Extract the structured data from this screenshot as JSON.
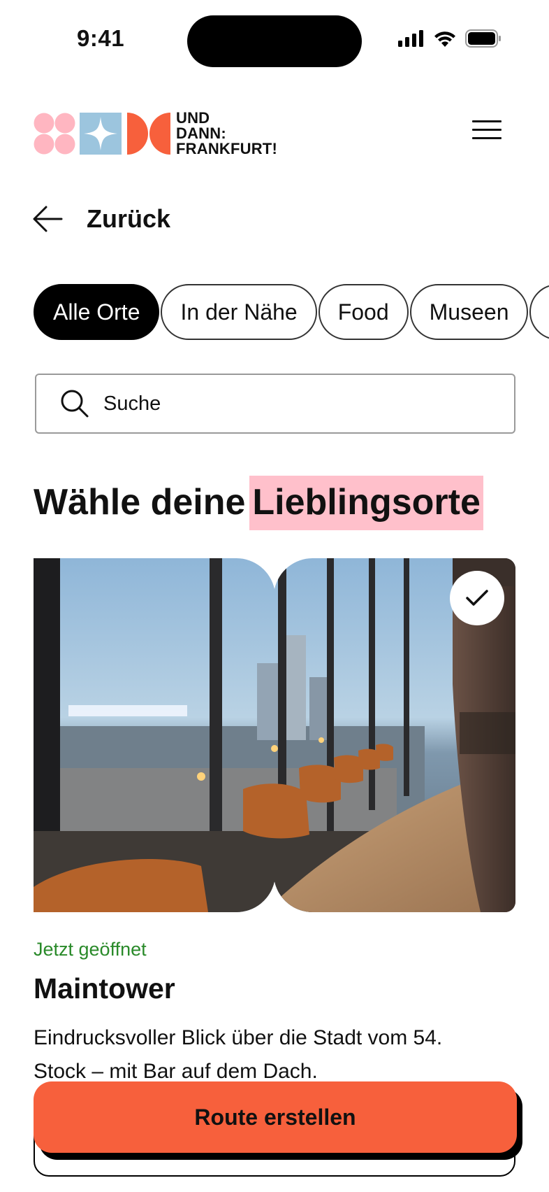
{
  "status_bar": {
    "time": "9:41"
  },
  "header": {
    "logo_text": "UND\nDANN:\nFRANKFURT!"
  },
  "nav": {
    "back_label": "Zurück"
  },
  "filters": [
    {
      "label": "Alle Orte",
      "active": true
    },
    {
      "label": "In der Nähe",
      "active": false
    },
    {
      "label": "Food",
      "active": false
    },
    {
      "label": "Museen",
      "active": false
    }
  ],
  "search": {
    "placeholder": "Suche"
  },
  "heading": {
    "part1": "Wähle deine",
    "highlight": "Lieblingsorte"
  },
  "place": {
    "status": "Jetzt geöffnet",
    "name": "Maintower",
    "description": "Eindrucksvoller Blick über die Stadt vom 54. Stock – mit Bar auf dem Dach.",
    "selected": true
  },
  "cta": {
    "label": "Route erstellen"
  },
  "colors": {
    "accent": "#f7603c",
    "highlight": "#ffc0cb",
    "open_status": "#2a8a2a",
    "logo_blue": "#9cc5de",
    "logo_pink": "#ffb6c1"
  }
}
